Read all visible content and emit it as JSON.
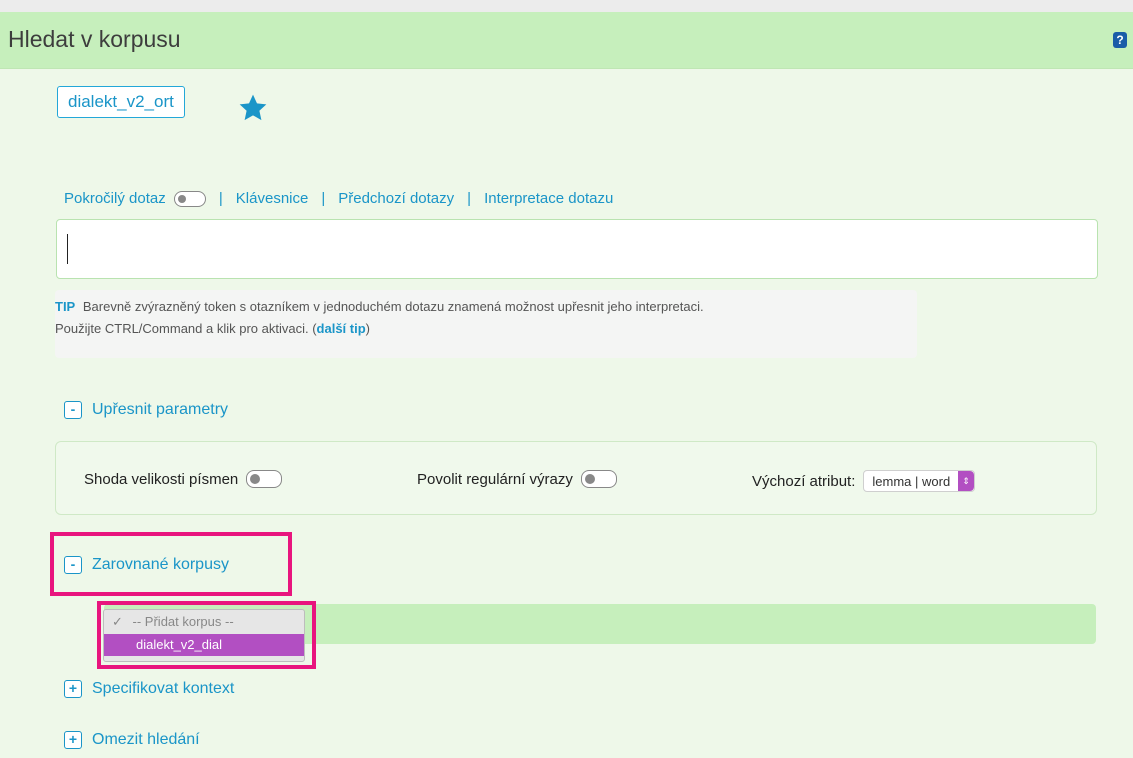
{
  "header": {
    "title": "Hledat v korpusu",
    "help_label": "?"
  },
  "corpus": {
    "name": "dialekt_v2_ort"
  },
  "query_links": {
    "advanced_query": "Pokročilý dotaz",
    "keyboard": "Klávesnice",
    "previous_queries": "Předchozí dotazy",
    "interpretation": "Interpretace dotazu"
  },
  "query_input": {
    "value": ""
  },
  "tip": {
    "label": "TIP",
    "line1": "Barevně zvýrazněný token s otazníkem v jednoduchém dotazu znamená možnost upřesnit jeho interpretaci.",
    "line2_prefix": "Použijte CTRL/Command a klik pro aktivaci. (",
    "link": "další tip",
    "line2_suffix": ")"
  },
  "sections": {
    "refine": {
      "toggle": "-",
      "label": "Upřesnit parametry"
    },
    "aligned": {
      "toggle": "-",
      "label": "Zarovnané korpusy"
    },
    "context": {
      "toggle": "+",
      "label": "Specifikovat kontext"
    },
    "restrict": {
      "toggle": "+",
      "label": "Omezit hledání"
    }
  },
  "params": {
    "case": "Shoda velikosti písmen",
    "regex": "Povolit regulární výrazy",
    "default_attr_label": "Výchozí atribut:",
    "default_attr_value": "lemma | word"
  },
  "aligned_dropdown": {
    "options": [
      "-- Přidat korpus --",
      "dialekt_v2_dial"
    ],
    "checkmark": "✓"
  },
  "colors": {
    "accent": "#1a95c8",
    "highlight": "#e8157e",
    "header_bg": "#c6efbc",
    "select_purple": "#b24fc2"
  }
}
